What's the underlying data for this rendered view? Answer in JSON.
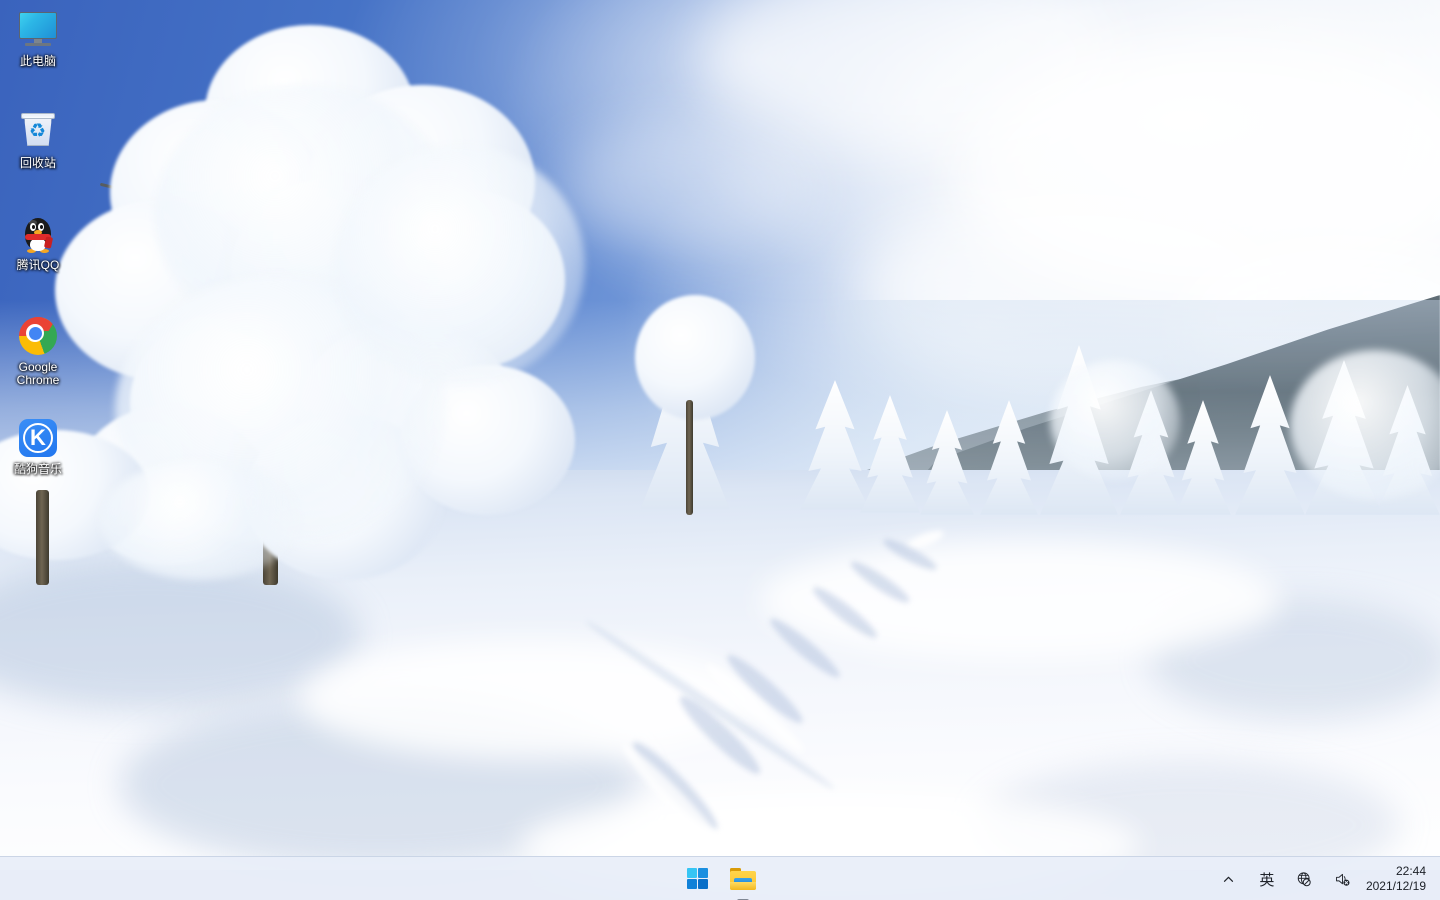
{
  "desktop": {
    "wallpaper_description": "Snow-covered winter landscape with frosted trees, blue sky and footprint trail in snow",
    "icons": [
      {
        "id": "this-pc",
        "label": "此电脑",
        "icon": "monitor-icon"
      },
      {
        "id": "recycle-bin",
        "label": "回收站",
        "icon": "recycle-bin-icon"
      },
      {
        "id": "tencent-qq",
        "label": "腾讯QQ",
        "icon": "qq-penguin-icon"
      },
      {
        "id": "google-chrome",
        "label": "Google\nChrome",
        "icon": "chrome-icon"
      },
      {
        "id": "kugou-music",
        "label": "酷狗音乐",
        "icon": "kugou-music-icon"
      }
    ]
  },
  "taskbar": {
    "start_label": "开始",
    "start_icon": "windows-logo-icon",
    "apps": [
      {
        "id": "file-explorer",
        "label": "文件资源管理器",
        "icon": "folder-icon",
        "running": true
      }
    ],
    "tray": [
      {
        "id": "show-hidden-icons",
        "icon": "chevron-up-icon",
        "glyph": "︿"
      },
      {
        "id": "ime-indicator",
        "icon": "ime-icon",
        "glyph": "英"
      },
      {
        "id": "network",
        "icon": "globe-no-internet-icon",
        "glyph": ""
      },
      {
        "id": "volume",
        "icon": "speaker-muted-icon",
        "glyph": ""
      }
    ],
    "clock": {
      "time": "22:44",
      "date": "2021/12/19"
    }
  },
  "colors": {
    "taskbar_bg": "#e8eef8",
    "win_blue_1": "#36c5f4",
    "win_blue_2": "#1b8fe0",
    "win_blue_3": "#1081d8",
    "win_blue_4": "#0a6fc8",
    "sky_blue": "#4572c6",
    "snow_white": "#f3f6fc",
    "icon_label": "#ffffff"
  }
}
